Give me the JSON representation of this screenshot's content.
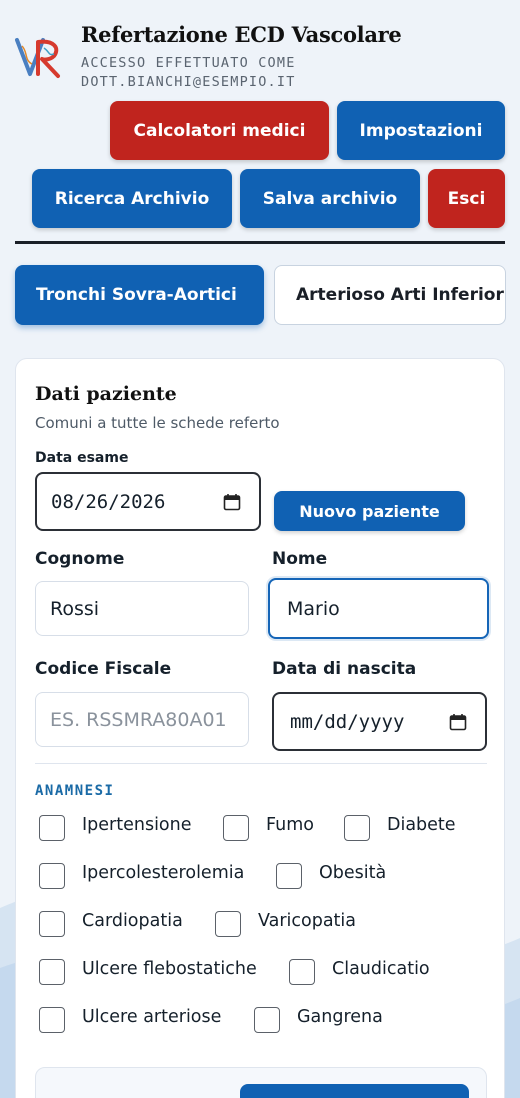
{
  "header": {
    "title": "Refertazione ECD Vascolare",
    "login_line1": "ACCESSO EFFETTUATO COME",
    "login_line2": "DOTT.BIANCHI@ESEMPIO.IT",
    "logo_icon": "vr-logo-icon"
  },
  "toolbar": {
    "calc_label": "Calcolatori medici",
    "settings_label": "Impostazioni",
    "search_label": "Ricerca Archivio",
    "save_label": "Salva archivio",
    "exit_label": "Esci"
  },
  "tabs": [
    {
      "label": "Tronchi Sovra-Aortici",
      "active": true
    },
    {
      "label": "Arterioso Arti Inferiori",
      "active": false
    }
  ],
  "patient": {
    "title": "Dati paziente",
    "subtitle": "Comuni a tutte le schede referto",
    "exam_date_label": "Data esame",
    "exam_date_value": "08/26/2026",
    "new_patient_label": "Nuovo paziente",
    "surname_label": "Cognome",
    "surname_value": "Rossi",
    "name_label": "Nome",
    "name_value": "Mario",
    "tax_code_label": "Codice Fiscale",
    "tax_code_placeholder": "ES. RSSMRA80A01",
    "birth_date_label": "Data di nascita",
    "birth_date_placeholder": "mm/dd/yyyy"
  },
  "anamnesis": {
    "heading": "ANAMNESI",
    "items": [
      "Ipertensione",
      "Fumo",
      "Diabete",
      "Ipercolesterolemia",
      "Obesità",
      "Cardiopatia",
      "Varicopatia",
      "Ulcere flebostatiche",
      "Claudicatio",
      "Ulcere arteriose",
      "Gangrena"
    ]
  },
  "colors": {
    "primary_blue": "#1061b3",
    "danger_red": "#c0241e",
    "section_accent": "#1a6aa6",
    "background": "#eef3f9"
  },
  "icons": {
    "calendar": "calendar-icon"
  }
}
